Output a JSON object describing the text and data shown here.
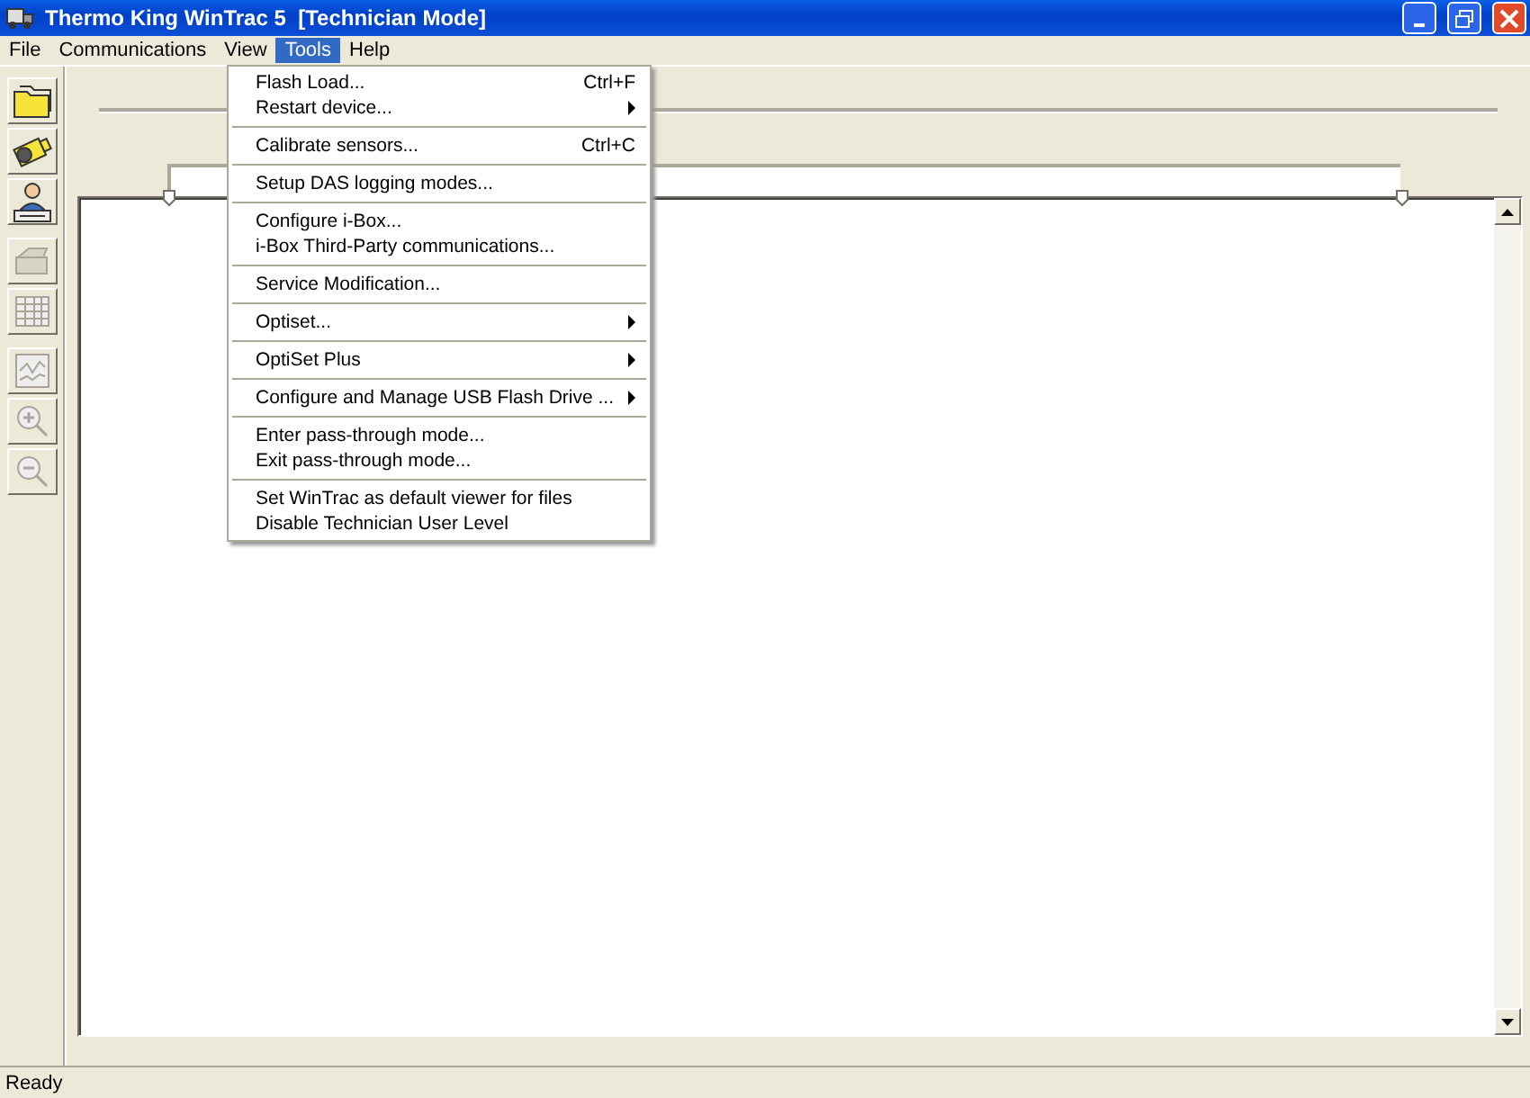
{
  "window": {
    "title": "Thermo King WinTrac 5  [Technician Mode]"
  },
  "menu_bar": [
    {
      "label": "File",
      "selected": false
    },
    {
      "label": "Communications",
      "selected": false
    },
    {
      "label": "View",
      "selected": false
    },
    {
      "label": "Tools",
      "selected": true
    },
    {
      "label": "Help",
      "selected": false
    }
  ],
  "toolbar": [
    {
      "disabled": false
    },
    {
      "disabled": false
    },
    {
      "disabled": false
    },
    {
      "disabled": true
    },
    {
      "disabled": true
    },
    {
      "disabled": true
    },
    {
      "disabled": true
    },
    {
      "disabled": true
    }
  ],
  "tools_menu": [
    {
      "kind": "item",
      "label": "Flash Load...",
      "shortcut": "Ctrl+F",
      "submenu": false
    },
    {
      "kind": "item",
      "label": "Restart device...",
      "submenu": true
    },
    {
      "kind": "separator"
    },
    {
      "kind": "item",
      "label": "Calibrate sensors...",
      "shortcut": "Ctrl+C",
      "submenu": false
    },
    {
      "kind": "separator"
    },
    {
      "kind": "item",
      "label": "Setup DAS logging modes...",
      "submenu": false
    },
    {
      "kind": "separator"
    },
    {
      "kind": "item",
      "label": "Configure i-Box...",
      "submenu": false
    },
    {
      "kind": "item",
      "label": "i-Box Third-Party communications...",
      "submenu": false
    },
    {
      "kind": "separator"
    },
    {
      "kind": "item",
      "label": "Service Modification...",
      "submenu": false
    },
    {
      "kind": "separator"
    },
    {
      "kind": "item",
      "label": "Optiset...",
      "submenu": true
    },
    {
      "kind": "separator"
    },
    {
      "kind": "item",
      "label": "OptiSet Plus",
      "submenu": true
    },
    {
      "kind": "separator"
    },
    {
      "kind": "item",
      "label": "Configure and Manage USB Flash Drive ...",
      "submenu": true
    },
    {
      "kind": "separator"
    },
    {
      "kind": "item",
      "label": "Enter pass-through mode...",
      "submenu": false
    },
    {
      "kind": "item",
      "label": "Exit pass-through mode...",
      "submenu": false
    },
    {
      "kind": "separator"
    },
    {
      "kind": "item",
      "label": "Set WinTrac as default viewer for files",
      "submenu": false
    },
    {
      "kind": "item",
      "label": "Disable Technician User Level",
      "submenu": false
    }
  ],
  "status_bar": {
    "text": "Ready"
  }
}
